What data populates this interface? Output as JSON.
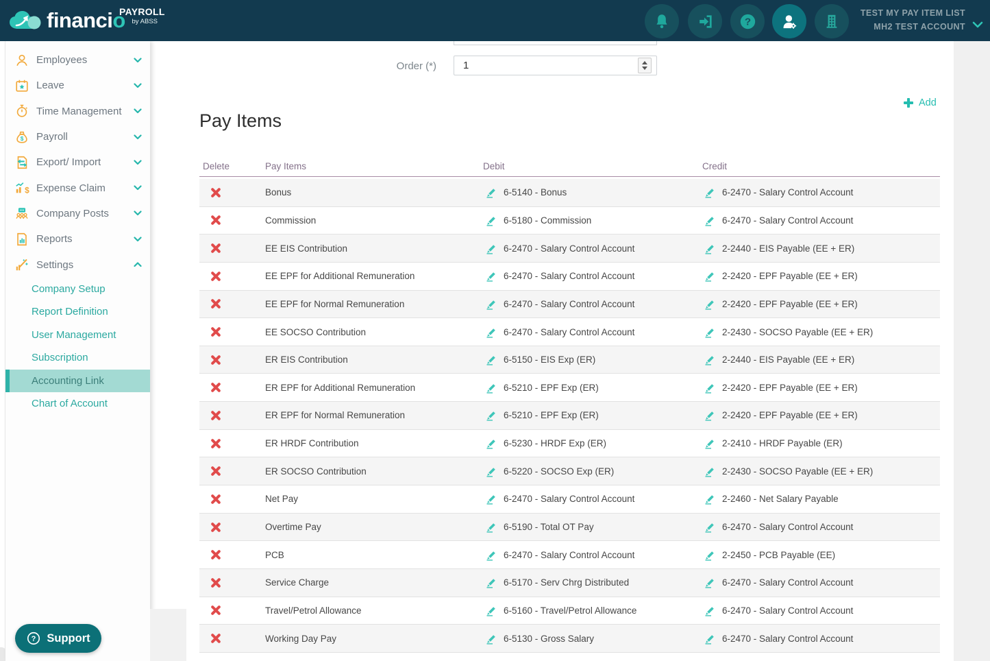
{
  "brand": {
    "name_main": "financi",
    "name_accent": "o",
    "product": "PAYROLL",
    "byline": "by ABSS"
  },
  "header": {
    "workspace_line1": "TEST MY PAY ITEM LIST",
    "workspace_line2": "MH2 TEST ACCOUNT"
  },
  "sidebar": {
    "items": [
      {
        "label": "Employees"
      },
      {
        "label": "Leave"
      },
      {
        "label": "Time Management"
      },
      {
        "label": "Payroll"
      },
      {
        "label": "Export/ Import"
      },
      {
        "label": "Expense Claim"
      },
      {
        "label": "Company Posts"
      },
      {
        "label": "Reports"
      },
      {
        "label": "Settings"
      }
    ],
    "settings_children": [
      {
        "label": "Company Setup"
      },
      {
        "label": "Report Definition"
      },
      {
        "label": "User Management"
      },
      {
        "label": "Subscription"
      },
      {
        "label": "Accounting Link"
      },
      {
        "label": "Chart of Account"
      }
    ],
    "selected_child": "Accounting Link"
  },
  "form": {
    "order_label": "Order (*)",
    "order_value": "1"
  },
  "content": {
    "title": "Pay Items",
    "add_label": "Add"
  },
  "table": {
    "columns": {
      "delete": "Delete",
      "pay_item": "Pay Items",
      "debit": "Debit",
      "credit": "Credit"
    },
    "rows": [
      {
        "name": "Bonus",
        "debit": "6-5140 - Bonus",
        "credit": "6-2470 - Salary Control Account"
      },
      {
        "name": "Commission",
        "debit": "6-5180 - Commission",
        "credit": "6-2470 - Salary Control Account"
      },
      {
        "name": "EE EIS Contribution",
        "debit": "6-2470 - Salary Control Account",
        "credit": "2-2440 - EIS Payable (EE + ER)"
      },
      {
        "name": "EE EPF for Additional Remuneration",
        "debit": "6-2470 - Salary Control Account",
        "credit": "2-2420 - EPF Payable (EE + ER)"
      },
      {
        "name": "EE EPF for Normal Remuneration",
        "debit": "6-2470 - Salary Control Account",
        "credit": "2-2420 - EPF Payable (EE + ER)"
      },
      {
        "name": "EE SOCSO Contribution",
        "debit": "6-2470 - Salary Control Account",
        "credit": "2-2430 - SOCSO Payable (EE + ER)"
      },
      {
        "name": "ER EIS Contribution",
        "debit": "6-5150 - EIS Exp (ER)",
        "credit": "2-2440 - EIS Payable (EE + ER)"
      },
      {
        "name": "ER EPF for Additional Remuneration",
        "debit": "6-5210 - EPF Exp (ER)",
        "credit": "2-2420 - EPF Payable (EE + ER)"
      },
      {
        "name": "ER EPF for Normal Remuneration",
        "debit": "6-5210 - EPF Exp (ER)",
        "credit": "2-2420 - EPF Payable (EE + ER)"
      },
      {
        "name": "ER HRDF Contribution",
        "debit": "6-5230 - HRDF Exp (ER)",
        "credit": "2-2410 - HRDF Payable (ER)"
      },
      {
        "name": "ER SOCSO Contribution",
        "debit": "6-5220 - SOCSO Exp (ER)",
        "credit": "2-2430 - SOCSO Payable (EE + ER)"
      },
      {
        "name": "Net Pay",
        "debit": "6-2470 - Salary Control Account",
        "credit": "2-2460 - Net Salary Payable"
      },
      {
        "name": "Overtime Pay",
        "debit": "6-5190 - Total OT Pay",
        "credit": "6-2470 - Salary Control Account"
      },
      {
        "name": "PCB",
        "debit": "6-2470 - Salary Control Account",
        "credit": "2-2450 - PCB Payable (EE)"
      },
      {
        "name": "Service Charge",
        "debit": "6-5170 - Serv Chrg Distributed",
        "credit": "6-2470 - Salary Control Account"
      },
      {
        "name": "Travel/Petrol Allowance",
        "debit": "6-5160 - Travel/Petrol Allowance",
        "credit": "6-2470 - Salary Control Account"
      },
      {
        "name": "Working Day Pay",
        "debit": "6-5130 - Gross Salary",
        "credit": "6-2470 - Salary Control Account"
      }
    ]
  },
  "support": {
    "label": "Support"
  },
  "colors": {
    "header_bg": "#123a4f",
    "accent_teal": "#2ec4b6",
    "icon_orange": "#f2a93b",
    "delete_red": "#e14b4b",
    "pencil_teal": "#3fc6b9",
    "table_header_text": "#84718a",
    "selected_item_bg": "#a3dad3",
    "row_shade": "#f5f5f5",
    "support_bg": "#0c7077"
  }
}
